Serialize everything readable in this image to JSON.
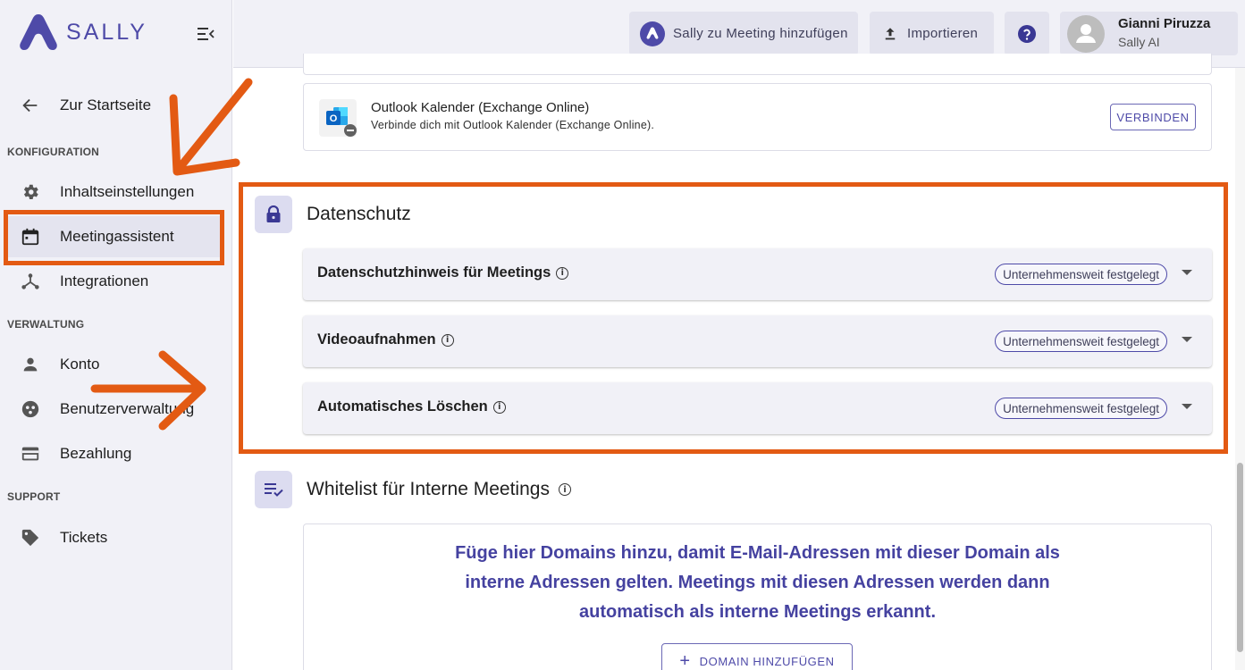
{
  "brand": {
    "name": "SALLY",
    "color": "#4e4aa8"
  },
  "sidebar": {
    "back_label": "Zur Startseite",
    "sections": [
      {
        "heading": "KONFIGURATION",
        "items": [
          {
            "label": "Inhaltseinstellungen",
            "icon": "gear-icon"
          },
          {
            "label": "Meetingassistent",
            "icon": "calendar-icon",
            "active": true
          },
          {
            "label": "Integrationen",
            "icon": "integrations-icon"
          }
        ]
      },
      {
        "heading": "VERWALTUNG",
        "items": [
          {
            "label": "Konto",
            "icon": "person-icon"
          },
          {
            "label": "Benutzerverwaltung",
            "icon": "users-icon"
          },
          {
            "label": "Bezahlung",
            "icon": "credit-card-icon"
          }
        ]
      },
      {
        "heading": "SUPPORT",
        "items": [
          {
            "label": "Tickets",
            "icon": "tag-icon"
          }
        ]
      }
    ]
  },
  "topbar": {
    "add_to_meeting_label": "Sally zu Meeting hinzufügen",
    "import_label": "Importieren",
    "help_icon": "help-icon",
    "user": {
      "name": "Gianni Piruzza",
      "org": "Sally AI"
    }
  },
  "outlook": {
    "title": "Outlook Kalender (Exchange Online)",
    "description": "Verbinde dich mit Outlook Kalender (Exchange Online).",
    "connect_label": "VERBINDEN"
  },
  "privacy": {
    "title": "Datenschutz",
    "accordions": [
      {
        "title": "Datenschutzhinweis für Meetings",
        "chip": "Unternehmensweit festgelegt"
      },
      {
        "title": "Videoaufnahmen",
        "chip": "Unternehmensweit festgelegt"
      },
      {
        "title": "Automatisches Löschen",
        "chip": "Unternehmensweit festgelegt"
      }
    ]
  },
  "whitelist": {
    "title": "Whitelist für Interne Meetings",
    "description_lines": [
      "Füge hier Domains hinzu, damit E-Mail-Adressen mit dieser Domain als",
      "interne Adressen gelten. Meetings mit diesen Adressen werden dann",
      "automatisch als interne Meetings erkannt."
    ],
    "add_domain_label": "DOMAIN HINZUFÜGEN"
  },
  "annotation_color": "#e35a13"
}
